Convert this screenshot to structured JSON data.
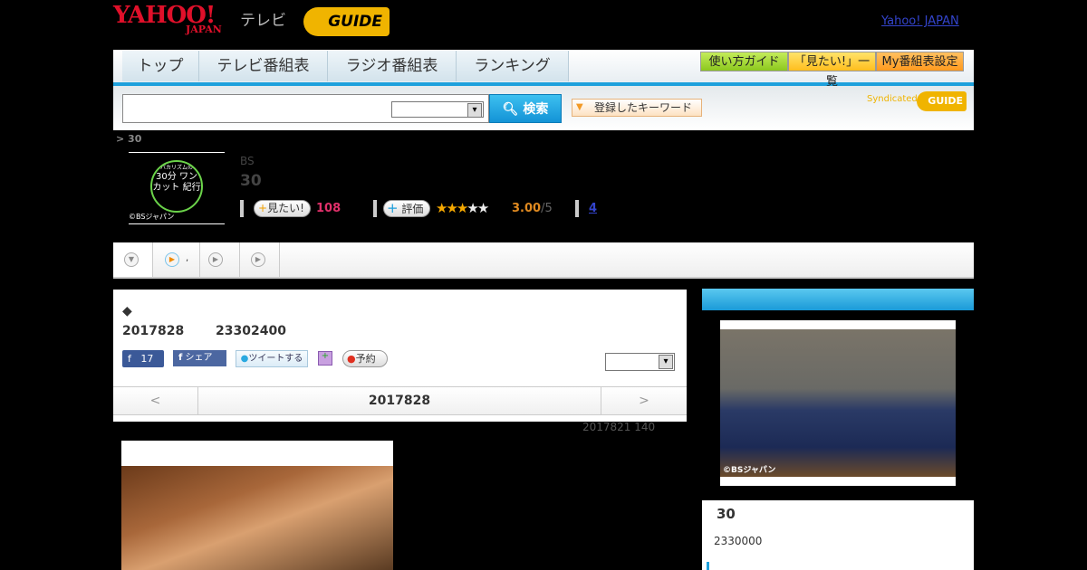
{
  "header": {
    "yahoo": "YAHOO!",
    "japan": "JAPAN",
    "tv": "テレビ",
    "gguide": "GUIDE",
    "yahoo_japan_link": "Yahoo! JAPAN"
  },
  "nav": {
    "tabs": [
      "トップ",
      "テレビ番組表",
      "ラジオ番組表",
      "ランキング"
    ],
    "guide": "使い方ガイド",
    "mitai_list": "「見たい!」一覧",
    "my_settings": "My番組表設定"
  },
  "search": {
    "placeholder": "",
    "button": "検索",
    "keywords": "登録したキーワード",
    "syndicated": "Syndicated",
    "gguide": "GUIDE"
  },
  "breadcrumb": "> 30",
  "program": {
    "thumb_text_top": "バカリズムの",
    "thumb_text_main": "30分 ワンカット 紀行",
    "thumb_copyright": "©BSジャパン",
    "channel": "BS",
    "title": "30",
    "mitai_label": "見たい!",
    "mitai_count": "108",
    "rate_label": "評価",
    "rating": 3,
    "rating_max": 5,
    "rating_text": "3.00",
    "rating_suffix": "/5",
    "reviews": "4"
  },
  "tabs2": {
    "items": [
      "",
      ",",
      " ",
      ""
    ]
  },
  "episode": {
    "diamond": "◆",
    "date": "2017828",
    "time": "23302400",
    "fb_count": "17",
    "fb_share": "シェア",
    "tweet": "ツイートする",
    "reserve": "予約",
    "prev": "<",
    "current_date": "2017828",
    "next": ">",
    "prev_note": "2017821  140"
  },
  "side": {
    "copyright": "©BSジャパン",
    "title": "30",
    "time": "2330000"
  },
  "colors": {
    "accent": "#1ea0dc",
    "pink": "#e0306a",
    "star": "#f5a800"
  }
}
